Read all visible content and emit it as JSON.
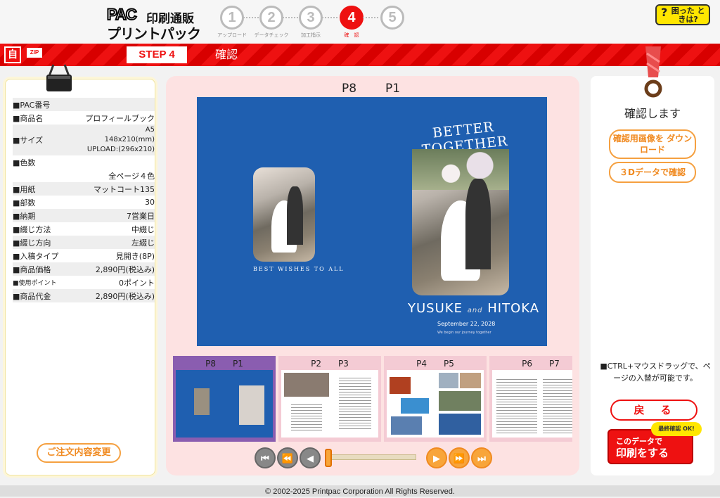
{
  "header": {
    "logo_pac": "PAC",
    "logo_line1": "印刷通販",
    "logo_line2": "プリントパック",
    "steps": [
      {
        "num": "1",
        "label": "アップロード"
      },
      {
        "num": "2",
        "label": "データチェック"
      },
      {
        "num": "3",
        "label": "加工指示"
      },
      {
        "num": "4",
        "label": "確　認"
      },
      {
        "num": "5",
        "label": ""
      }
    ],
    "help_mark": "?",
    "help_label": "困った ときは?"
  },
  "bar": {
    "icon1": "自",
    "icon2": "ZIP",
    "step": "STEP 4",
    "title": "確認"
  },
  "order": {
    "rows": [
      {
        "k": "■PAC番号",
        "v": ""
      },
      {
        "k": "■商品名",
        "v": "プロフィールブック"
      },
      {
        "k": "■サイズ",
        "v1": "A5",
        "v2": "148x210(mm)",
        "v3": "UPLOAD:(296x210)"
      },
      {
        "k": "■色数",
        "v": ""
      },
      {
        "k": "",
        "v": "全ページ４色"
      },
      {
        "k": "■用紙",
        "v": "マットコート135"
      },
      {
        "k": "■部数",
        "v": "30"
      },
      {
        "k": "■納期",
        "v": "7営業日"
      },
      {
        "k": "■綴じ方法",
        "v": "中綴じ"
      },
      {
        "k": "■綴じ方向",
        "v": "左綴じ"
      },
      {
        "k": "■入稿タイプ",
        "v": "見開き(8P)"
      },
      {
        "k": "■商品価格",
        "v": "2,890円(税込み)"
      },
      {
        "k": "■使用ポイント",
        "v": "0ポイント"
      },
      {
        "k": "■商品代金",
        "v": "2,890円(税込み)"
      }
    ],
    "change_button": "ご注文内容変更"
  },
  "preview": {
    "left_label": "P8",
    "right_label": "P1",
    "best_wishes": "BEST WISHES TO ALL",
    "better_together": "BETTER TOGETHER",
    "name1": "YUSUKE",
    "and": "and",
    "name2": "HITOKA",
    "date": "September 22, 2028",
    "tagline": "We begin our journey together"
  },
  "thumbnails": [
    {
      "a": "P8",
      "b": "P1"
    },
    {
      "a": "P2",
      "b": "P3"
    },
    {
      "a": "P4",
      "b": "P5"
    },
    {
      "a": "P6",
      "b": "P7"
    }
  ],
  "controls": {
    "first": "⏮",
    "prev_fast": "⏪",
    "prev": "◀",
    "next": "▶",
    "next_fast": "⏩",
    "last": "⏭",
    "slider_value": 0
  },
  "right": {
    "confirm_title": "確認します",
    "download_button": "確認用画像を ダウンロード",
    "d3_button": "３Dデータで確認",
    "note": "■CTRL+マウスドラッグで、ページの入替が可能です。",
    "back_button": "戻　る",
    "ok_badge": "最終確認 OK!",
    "print_line1": "このデータで",
    "print_line2": "印刷をする"
  },
  "footer": {
    "copyright": "© 2002-2025 Printpac Corporation All Rights Reserved."
  }
}
